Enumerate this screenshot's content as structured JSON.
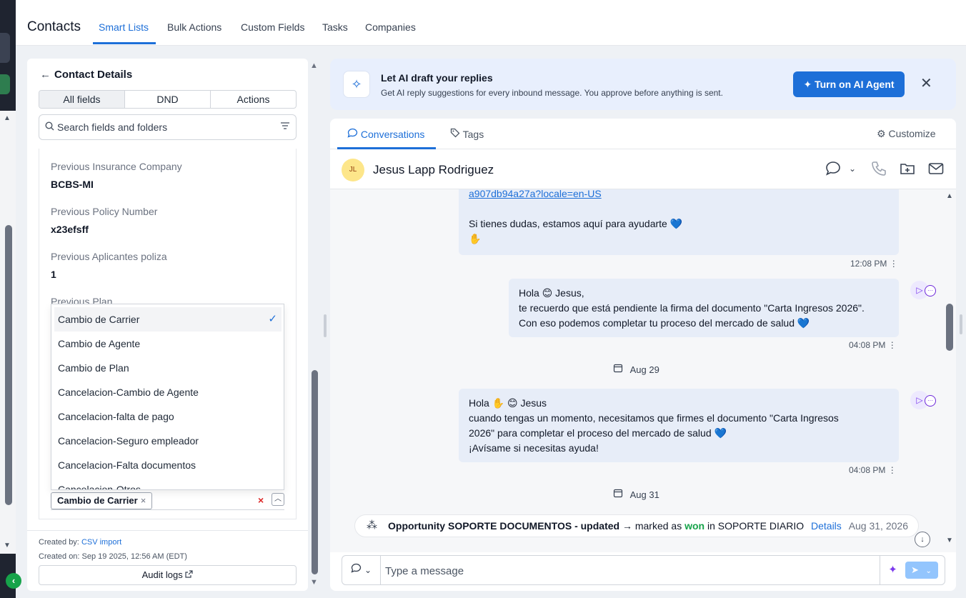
{
  "header": {
    "title": "Contacts",
    "tabs": [
      "Smart Lists",
      "Bulk Actions",
      "Custom Fields",
      "Tasks",
      "Companies"
    ]
  },
  "left_panel": {
    "title": "Contact Details",
    "segments": [
      "All fields",
      "DND",
      "Actions"
    ],
    "search_placeholder": "Search fields and folders",
    "fields": [
      {
        "label": "Previous Insurance Company",
        "value": "BCBS-MI"
      },
      {
        "label": "Previous Policy Number",
        "value": "x23efsff"
      },
      {
        "label": "Previous Aplicantes poliza",
        "value": "1"
      },
      {
        "label": "Previous Plan",
        "value": ""
      }
    ],
    "dropdown_options": [
      "Cambio de Carrier",
      "Cambio de Agente",
      "Cambio de Plan",
      "Cancelacion-Cambio de Agente",
      "Cancelacion-falta de pago",
      "Cancelacion-Seguro empleador",
      "Cancelacion-Falta documentos",
      "Cancelacion-Otros"
    ],
    "selected_chip": "Cambio de Carrier",
    "footer": {
      "created_by_label": "Created by:",
      "created_by_value": "CSV import",
      "created_on": "Created on: Sep 19 2025, 12:56 AM (EDT)",
      "audit_logs": "Audit logs"
    }
  },
  "ai_banner": {
    "title": "Let AI draft your replies",
    "subtitle": "Get AI reply suggestions for every inbound message. You approve before anything is sent.",
    "button": "Turn on AI Agent"
  },
  "conversation": {
    "tabs": {
      "conversations": "Conversations",
      "tags": "Tags",
      "customize": "Customize"
    },
    "contact": {
      "initials": "JL",
      "name": "Jesus Lapp Rodriguez"
    },
    "messages": [
      {
        "link": "a907db94a27a?locale=en-US",
        "lines": [
          "Si tienes dudas, estamos aquí para ayudarte 💙",
          "✋"
        ],
        "time": "12:08 PM"
      },
      {
        "lines": [
          "Hola 😊 Jesus,",
          "te recuerdo que está pendiente la firma del documento \"Carta Ingresos 2026\".",
          "Con eso podemos completar tu proceso del mercado de salud 💙"
        ],
        "time": "04:08 PM"
      },
      {
        "lines": [
          "Hola ✋ 😊 Jesus",
          "cuando tengas un momento, necesitamos que firmes el documento \"Carta Ingresos",
          "2026\" para completar el proceso del mercado de salud 💙",
          "¡Avísame si necesitas ayuda!"
        ],
        "time": "04:08 PM"
      }
    ],
    "dates": [
      "Aug 29",
      "Aug 31"
    ],
    "activity": {
      "bold": "Opportunity SOPORTE DOCUMENTOS - updated",
      "arrow": "→ marked as",
      "status": "won",
      "in_text": "in SOPORTE DIARIO",
      "details": "Details",
      "date": "Aug 31, 2026"
    },
    "composer_placeholder": "Type a message"
  }
}
